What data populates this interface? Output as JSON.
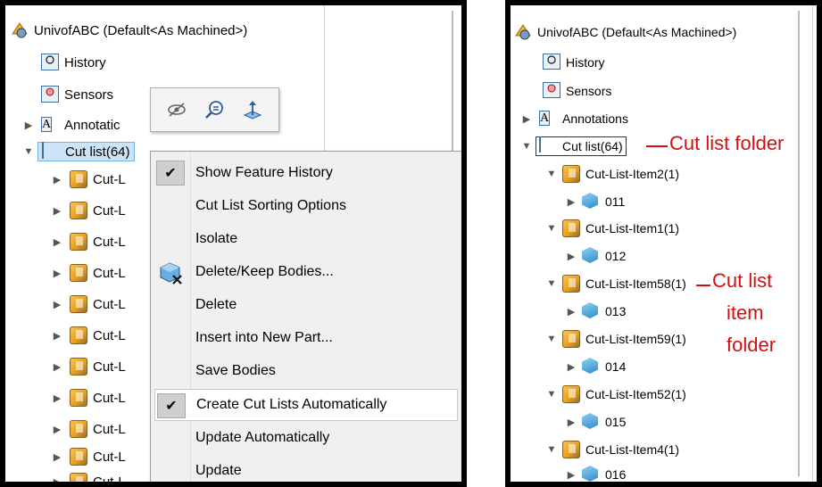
{
  "left": {
    "root_label": "UnivofABC (Default<As Machined>)",
    "history_label": "History",
    "sensors_label": "Sensors",
    "annotations_label": "Annotatic",
    "cutlist_label": "Cut list(64)",
    "item_label": "Cut-L",
    "toolbar": {
      "icons": [
        "hide-eye-icon",
        "zoom-to-selection-icon",
        "normal-to-icon"
      ]
    },
    "menu": {
      "items": [
        {
          "label": "Show Feature History",
          "checked": true
        },
        {
          "label": "Cut List Sorting Options"
        },
        {
          "label": "Isolate"
        },
        {
          "label": "Delete/Keep Bodies...",
          "icon": "delete-keep-bodies-icon"
        },
        {
          "label": "Delete"
        },
        {
          "label": "Insert into New Part..."
        },
        {
          "label": "Save Bodies"
        },
        {
          "label": "Create Cut Lists Automatically",
          "checked": true
        },
        {
          "label": "Update Automatically"
        },
        {
          "label": "Update"
        }
      ]
    }
  },
  "right": {
    "root_label": "UnivofABC (Default<As Machined>)",
    "history_label": "History",
    "sensors_label": "Sensors",
    "annotations_label": "Annotations",
    "cutlist_label": "Cut list(64)",
    "items": [
      {
        "label": "Cut-List-Item2(1)",
        "body": "011"
      },
      {
        "label": "Cut-List-Item1(1)",
        "body": "012"
      },
      {
        "label": "Cut-List-Item58(1)",
        "body": "013"
      },
      {
        "label": "Cut-List-Item59(1)",
        "body": "014"
      },
      {
        "label": "Cut-List-Item52(1)",
        "body": "015"
      },
      {
        "label": "Cut-List-Item4(1)",
        "body": "016"
      }
    ],
    "callouts": {
      "cutlist_folder": "Cut list folder",
      "item_folder_line1": "Cut list",
      "item_folder_line2": "item",
      "item_folder_line3": "folder"
    }
  },
  "colors": {
    "callout": "#d01010",
    "selection": "#cce4f7"
  }
}
